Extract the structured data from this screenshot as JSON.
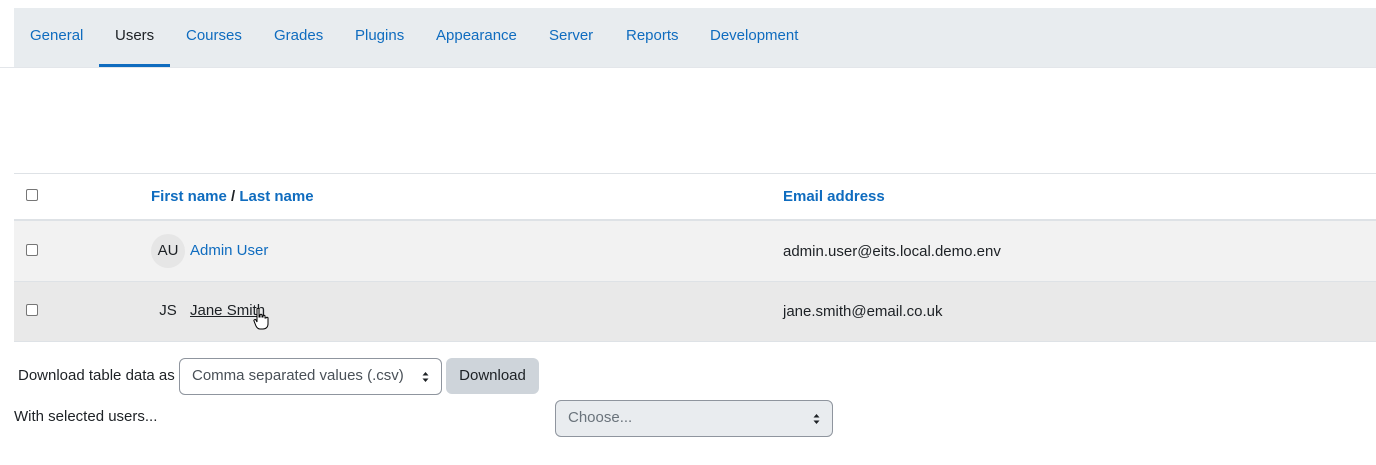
{
  "nav": {
    "tabs": [
      {
        "label": "General"
      },
      {
        "label": "Users"
      },
      {
        "label": "Courses"
      },
      {
        "label": "Grades"
      },
      {
        "label": "Plugins"
      },
      {
        "label": "Appearance"
      },
      {
        "label": "Server"
      },
      {
        "label": "Reports"
      },
      {
        "label": "Development"
      }
    ],
    "active_tab": "Users"
  },
  "table": {
    "headers": {
      "first_name": "First name",
      "separator": "/",
      "last_name": "Last name",
      "email": "Email address"
    },
    "rows": [
      {
        "initials": "AU",
        "name": "Admin User",
        "email": "admin.user@eits.local.demo.env",
        "selected": false
      },
      {
        "initials": "JS",
        "name": "Jane Smith",
        "email": "jane.smith@email.co.uk",
        "selected": false
      }
    ]
  },
  "download": {
    "label": "Download table data as",
    "format_value": "Comma separated values (.csv)",
    "button_label": "Download"
  },
  "bulk": {
    "label": "With selected users...",
    "placeholder": "Choose..."
  },
  "colors": {
    "link": "#0f6cbf",
    "tabbar_bg": "#e8ecef",
    "button_bg": "#ced4da"
  }
}
